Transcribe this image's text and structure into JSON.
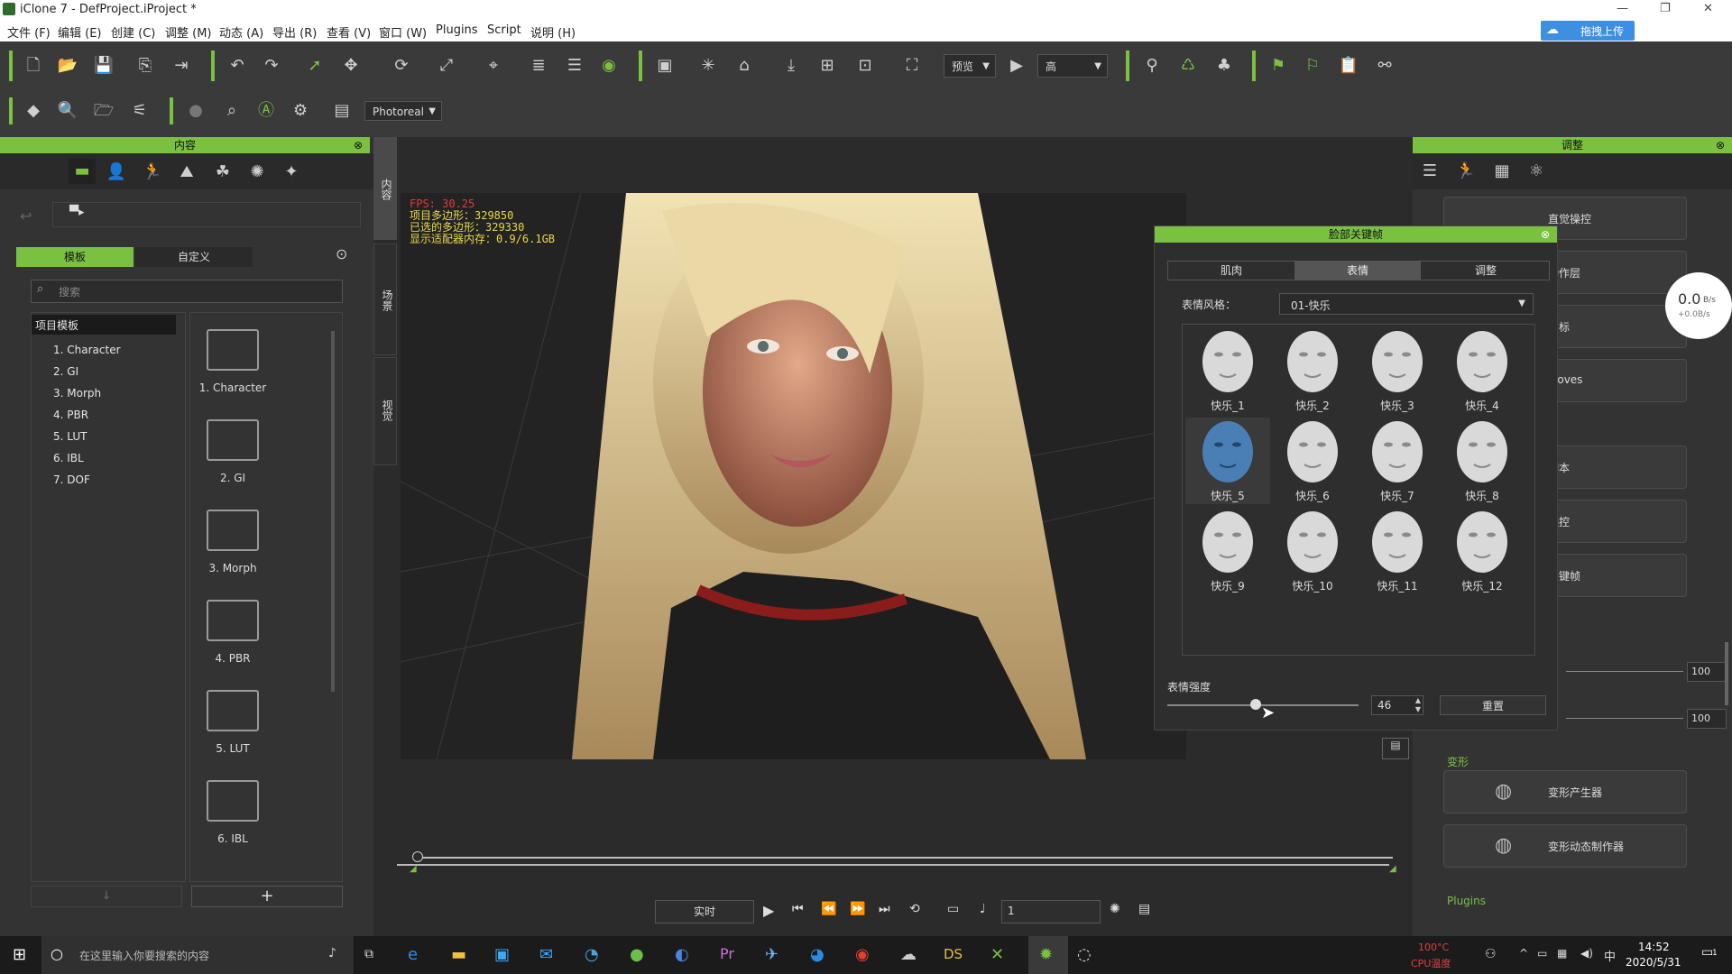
{
  "window": {
    "title": "iClone 7 - DefProject.iProject *"
  },
  "menu": [
    "文件 (F)",
    "编辑 (E)",
    "创建 (C)",
    "调整 (M)",
    "动态 (A)",
    "导出 (R)",
    "查看 (V)",
    "窗口 (W)",
    "Plugins",
    "Script",
    "说明 (H)"
  ],
  "upload_button": "拖拽上传",
  "toolbar": {
    "preview_select": "预览",
    "quality_select": "高",
    "render_select": "Photoreal"
  },
  "content_panel": {
    "title": "内容",
    "tabs": [
      "模板",
      "自定义"
    ],
    "search_placeholder": "搜索",
    "tree_root": "项目模板",
    "tree_items": [
      "1. Character",
      "2. GI",
      "3. Morph",
      "4. PBR",
      "5. LUT",
      "6. IBL",
      "7. DOF"
    ],
    "folders": [
      "1. Character",
      "2. GI",
      "3. Morph",
      "4. PBR",
      "5. LUT",
      "6. IBL"
    ],
    "side_tabs": [
      "内容",
      "场景",
      "视觉"
    ]
  },
  "viewport_stats": {
    "fps": "FPS: 30.25",
    "polys": "项目多边形：329850",
    "selected_polys": "已选的多边形：329330",
    "memory": "显示适配器内存：0.9/6.1GB"
  },
  "keyframe_dialog": {
    "title": "脸部关键帧",
    "tabs": [
      "肌肉",
      "表情",
      "调整"
    ],
    "style_label": "表情风格：",
    "style_value": "01-快乐",
    "faces": [
      "快乐_1",
      "快乐_2",
      "快乐_3",
      "快乐_4",
      "快乐_5",
      "快乐_6",
      "快乐_7",
      "快乐_8",
      "快乐_9",
      "快乐_10",
      "快乐_11",
      "快乐_12"
    ],
    "selected_face": "快乐_5",
    "strength_label": "表情强度",
    "strength_value": "46",
    "strength": 46,
    "reset_label": "重置"
  },
  "adjust_panel": {
    "title": "调整",
    "items": [
      "直觉操控",
      "动作层",
      "目标",
      "Moves",
      "脚本",
      "操控",
      "关键帧"
    ],
    "value1": "100",
    "value2": "100",
    "morph_section": "变形",
    "morph_items": [
      "变形产生器",
      "变形动态制作器"
    ],
    "plugins_section": "Plugins"
  },
  "netspeed": {
    "value": "0.0",
    "unit": "B/s",
    "sub": "+0.0B/s"
  },
  "playback": {
    "mode": "实时",
    "frame": "1"
  },
  "taskbar": {
    "search_placeholder": "在这里输入你要搜索的内容",
    "cpu_temp": "100°C",
    "cpu_label": "CPU温度",
    "time": "14:52",
    "date": "2020/5/31",
    "ime": "中",
    "notifications": "1"
  },
  "colors": {
    "accent": "#7ac142",
    "panel": "#333333",
    "selected": "#4a7fb5"
  }
}
